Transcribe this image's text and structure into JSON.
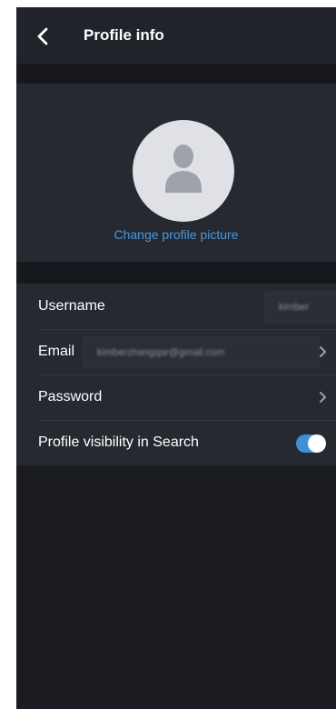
{
  "header": {
    "title": "Profile info",
    "back_icon": "chevron-left-icon"
  },
  "avatar": {
    "icon": "user-silhouette-icon",
    "change_label": "Change profile picture"
  },
  "rows": {
    "username": {
      "label": "Username",
      "value": "kimber"
    },
    "email": {
      "label": "Email",
      "value": "kimberzhangqar@gmail.com"
    },
    "password": {
      "label": "Password"
    },
    "visibility": {
      "label": "Profile visibility in Search",
      "enabled": true
    }
  },
  "colors": {
    "accent": "#4a98dd",
    "toggle_on": "#3f8fd6",
    "background": "#1a1c22",
    "panel": "#262930"
  }
}
